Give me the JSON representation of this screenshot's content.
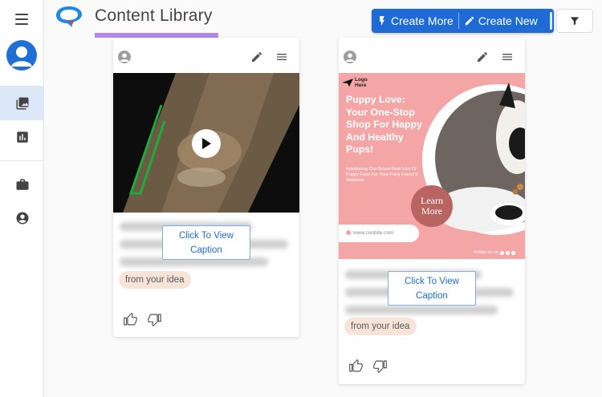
{
  "app": {
    "title": "Content Library"
  },
  "header": {
    "create_more_label": "Create More",
    "create_new_label": "Create New"
  },
  "colors": {
    "accent": "#1e6bd6",
    "title_underline": "#b388eb",
    "nav_active_bg": "#dde8f6",
    "chip_bg": "#f6e4d8",
    "promo_bg": "#f4a6a6"
  },
  "sidebar": {
    "items": [
      {
        "icon": "image-library-icon",
        "active": true
      },
      {
        "icon": "analytics-icon",
        "active": false
      },
      {
        "icon": "briefcase-icon",
        "active": false
      },
      {
        "icon": "account-circle-icon",
        "active": false
      }
    ]
  },
  "cards": [
    {
      "media_type": "video",
      "view_caption_label": "Click To View\nCaption",
      "chip_label": "from your idea"
    },
    {
      "media_type": "image",
      "view_caption_label": "Click To View\nCaption",
      "chip_label": "from your idea",
      "promo": {
        "logo_text": "Logo\nHere",
        "headline": "Puppy Love: Your One-Stop Shop For Happy And Healthy Pups!",
        "subtext": "Introducing Our Brand-New Line Of Puppy Food For Your Furry Friend'S Wellness",
        "cta": "Learn\nMore",
        "url": "www.coobite.com",
        "follow": "Follow us on"
      }
    }
  ]
}
